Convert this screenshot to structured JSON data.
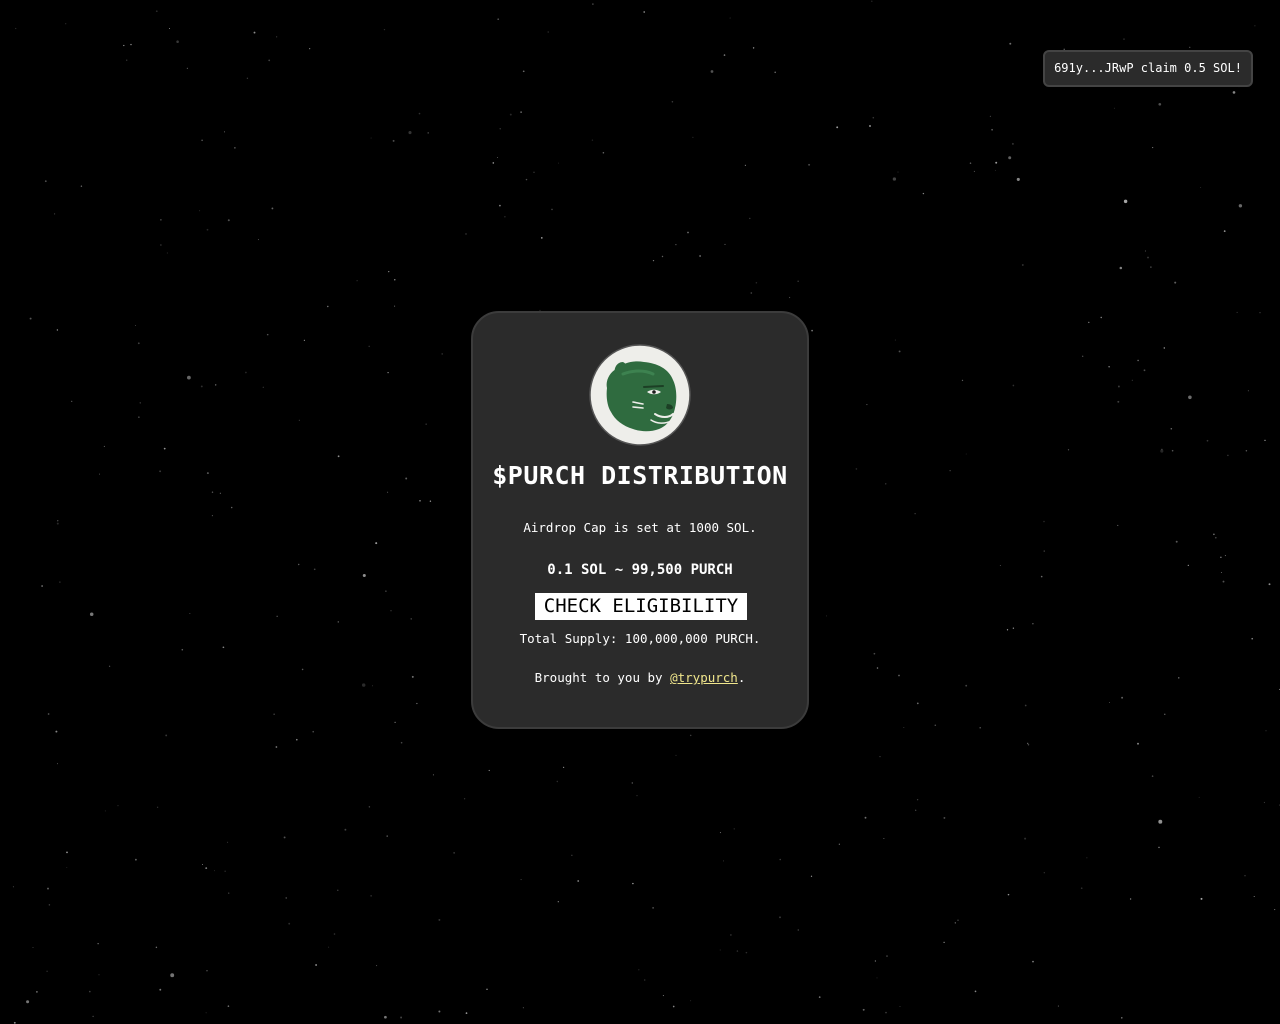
{
  "toast": {
    "message": "691y...JRwP claim 0.5 SOL!"
  },
  "card": {
    "logo_icon": "panther-head-logo",
    "title": "$PURCH DISTRIBUTION",
    "airdrop_cap": "Airdrop Cap is set at 1000 SOL.",
    "rate": "0.1 SOL ~ 99,500 PURCH",
    "check_button_label": "CHECK ELIGIBILITY",
    "total_supply": "Total Supply: 100,000,000 PURCH.",
    "brought_prefix": "Brought to you by ",
    "brought_link": "@trypurch",
    "brought_suffix": "."
  },
  "colors": {
    "background": "#000000",
    "card_bg": "#2b2b2b",
    "logo_green": "#2f6b3f",
    "logo_bg": "#eeeeea",
    "link": "#f0e68c"
  }
}
